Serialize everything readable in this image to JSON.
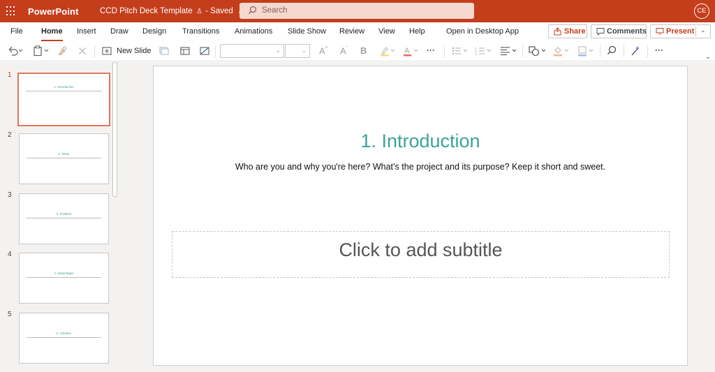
{
  "titlebar": {
    "app_name": "PowerPoint",
    "doc_title": "CCD Pitch Deck Template",
    "save_status": "Saved",
    "search_placeholder": "Search",
    "avatar_initials": "CE",
    "bg_color": "#c43e1c"
  },
  "menu": {
    "tabs": [
      "File",
      "Home",
      "Insert",
      "Draw",
      "Design",
      "Transitions",
      "Animations",
      "Slide Show",
      "Review",
      "View",
      "Help",
      "Open in Desktop App"
    ],
    "active_tab": "Home",
    "share_label": "Share",
    "comments_label": "Comments",
    "present_label": "Present"
  },
  "toolbar": {
    "new_slide_label": "New Slide",
    "icons": [
      "undo-icon",
      "paste-icon",
      "format-painter-icon",
      "delete-icon",
      "new-slide-icon",
      "reuse-slides-icon",
      "layout-icon",
      "section-icon",
      "font-name-dropdown",
      "font-size-dropdown",
      "grow-font-icon",
      "shrink-font-icon",
      "bold-icon",
      "highlight-icon",
      "font-color-icon",
      "more-icon",
      "bullets-icon",
      "numbering-icon",
      "align-icon",
      "shapes-icon",
      "shape-fill-icon",
      "shape-outline-icon",
      "find-icon",
      "designer-icon",
      "more-icon"
    ]
  },
  "thumbnails": [
    {
      "number": "1",
      "title": "1. Introduction",
      "active": true
    },
    {
      "number": "2",
      "title": "2. Team",
      "active": false
    },
    {
      "number": "3",
      "title": "3. Problem",
      "active": false
    },
    {
      "number": "4",
      "title": "4. Advantages",
      "active": false
    },
    {
      "number": "5",
      "title": "5. Solution",
      "active": false
    }
  ],
  "slide": {
    "title": "1. Introduction",
    "body": "Who are you and why you're here? What’s the project and its purpose? Keep it short and sweet.",
    "subtitle_placeholder": "Click to add subtitle",
    "accent_color": "#3aa39a"
  }
}
